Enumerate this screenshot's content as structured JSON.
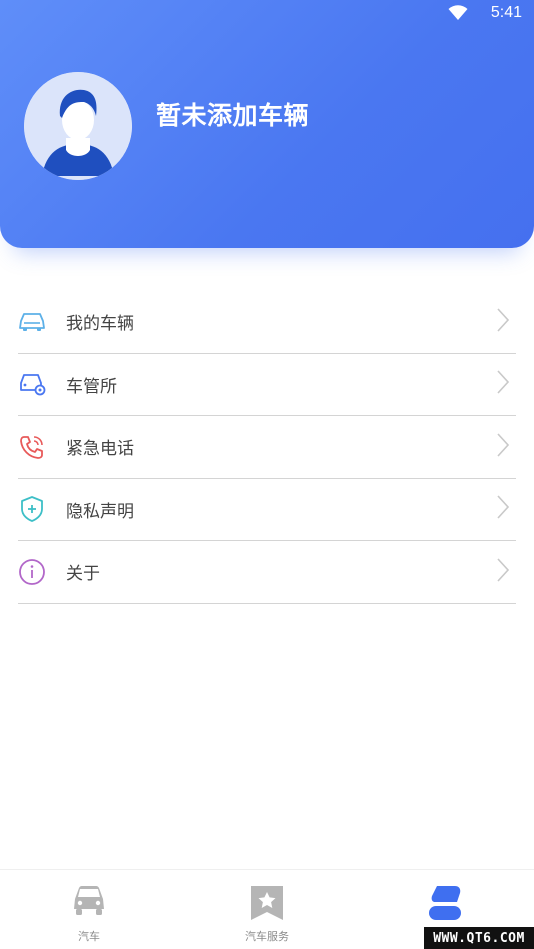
{
  "status_bar": {
    "time": "5:41",
    "wifi_icon": "wifi-icon"
  },
  "profile": {
    "title": "暂未添加车辆",
    "avatar_icon": "user-avatar-icon"
  },
  "menu": {
    "items": [
      {
        "label": "我的车辆",
        "icon": "car-outline-icon",
        "color": "#5cb0e8"
      },
      {
        "label": "车管所",
        "icon": "car-settings-icon",
        "color": "#4a77f1"
      },
      {
        "label": "紧急电话",
        "icon": "phone-ringing-icon",
        "color": "#e85a5a"
      },
      {
        "label": "隐私声明",
        "icon": "shield-plus-icon",
        "color": "#3dbfc7"
      },
      {
        "label": "关于",
        "icon": "info-icon",
        "color": "#b267c9"
      }
    ]
  },
  "tabbar": {
    "tabs": [
      {
        "label": "汽车",
        "icon": "car-icon",
        "active": false
      },
      {
        "label": "汽车服务",
        "icon": "bookmark-star-icon",
        "active": false
      },
      {
        "label": "",
        "icon": "profile-icon",
        "active": true
      }
    ],
    "active_color": "#3f6ff0",
    "inactive_color": "#b5b5b5"
  },
  "watermark": {
    "text": "WWW.QT6.COM"
  },
  "colors": {
    "header_start": "#5f8ef9",
    "header_end": "#4570ef"
  }
}
